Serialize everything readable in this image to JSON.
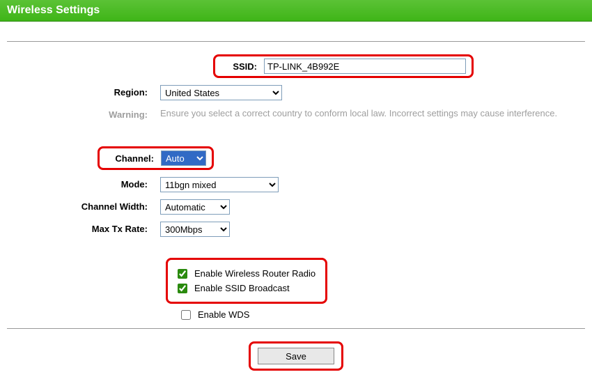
{
  "header": {
    "title": "Wireless Settings"
  },
  "form": {
    "ssid": {
      "label": "SSID:",
      "value": "TP-LINK_4B992E"
    },
    "region": {
      "label": "Region:",
      "value": "United States"
    },
    "warning": {
      "label": "Warning:",
      "text": "Ensure you select a correct country to conform local law. Incorrect settings may cause interference."
    },
    "channel": {
      "label": "Channel:",
      "value": "Auto"
    },
    "mode": {
      "label": "Mode:",
      "value": "11bgn mixed"
    },
    "channel_width": {
      "label": "Channel Width:",
      "value": "Automatic"
    },
    "max_tx_rate": {
      "label": "Max Tx Rate:",
      "value": "300Mbps"
    },
    "enable_radio": {
      "label": "Enable Wireless Router Radio",
      "checked": true
    },
    "enable_ssid_broadcast": {
      "label": "Enable SSID Broadcast",
      "checked": true
    },
    "enable_wds": {
      "label": "Enable WDS",
      "checked": false
    }
  },
  "buttons": {
    "save": "Save"
  },
  "colors": {
    "highlight": "#e50000",
    "header_bg": "#3fb518"
  }
}
